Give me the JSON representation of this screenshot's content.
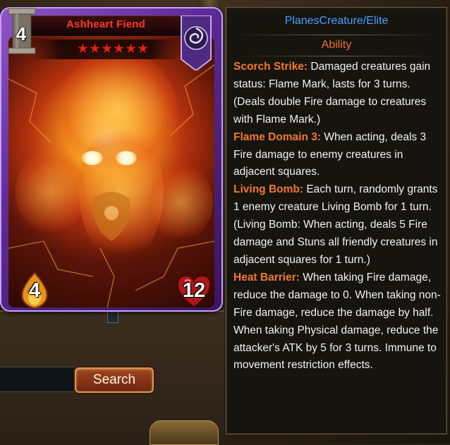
{
  "search": {
    "button_label": "Search",
    "input_value": ""
  },
  "card": {
    "name": "Ashheart Fiend",
    "stars": "★★★★★★",
    "star_count": 6,
    "cost": "4",
    "attack": "4",
    "health": "12",
    "faction_icon": "swirl-emblem-icon",
    "colors": {
      "frame": "#8f56c8",
      "name": "#ff3a2a",
      "stars": "#e0211a"
    }
  },
  "tooltip": {
    "type": "PlanesCreature/Elite",
    "section": "Ability",
    "colors": {
      "type": "#4aa0ff",
      "ability_name": "#f07a30",
      "text": "#f2f2f2"
    },
    "abilities": [
      {
        "name": "Scorch Strike:",
        "text": " Damaged creatures gain status: Flame Mark, lasts for 3 turns. (Deals double Fire damage to creatures with Flame Mark.)"
      },
      {
        "name": "Flame Domain 3:",
        "text": " When acting, deals 3 Fire damage to enemy creatures in adjacent squares."
      },
      {
        "name": "Living Bomb:",
        "text": " Each turn, randomly grants 1 enemy creature Living Bomb for 1 turn. (Living Bomb: When acting, deals 5 Fire damage and Stuns all friendly creatures in adjacent squares for 1 turn.)"
      },
      {
        "name": "Heat Barrier:",
        "text": " When taking Fire damage, reduce the damage to 0. When taking non-Fire damage, reduce the damage by half. When taking Physical damage, reduce the attacker's ATK by 5 for 3 turns. Immune to movement restriction effects."
      }
    ]
  }
}
